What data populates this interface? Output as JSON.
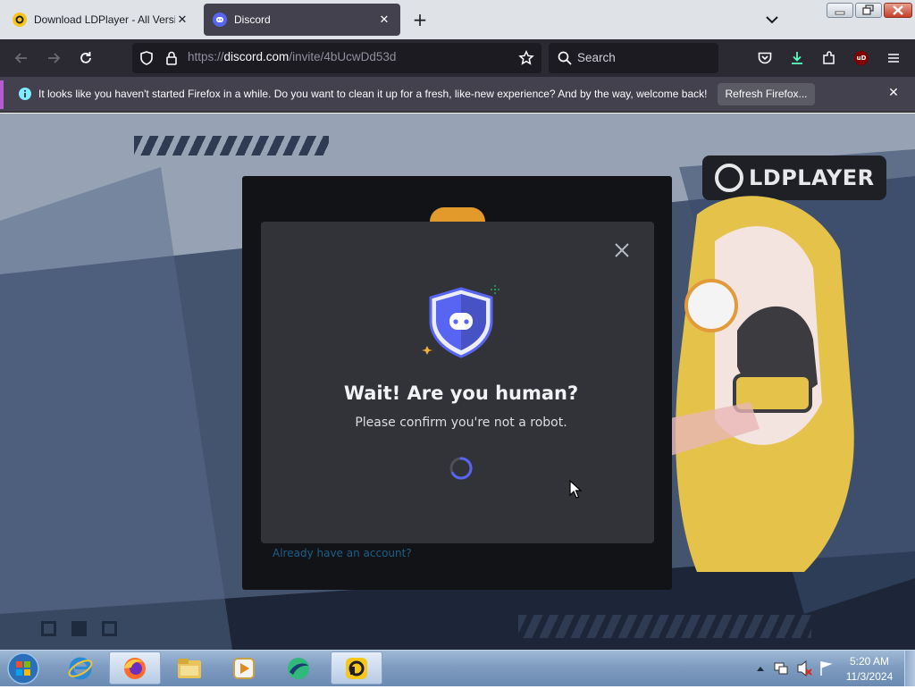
{
  "browser": {
    "tabs": [
      {
        "title": "Download LDPlayer - All Versio",
        "favicon": "ldplayer-icon",
        "active": false
      },
      {
        "title": "Discord",
        "favicon": "discord-icon",
        "active": true
      }
    ],
    "url_prefix": "https://",
    "url_host": "discord.com",
    "url_path": "/invite/4bUcwDd53d",
    "search_placeholder": "Search",
    "notification": {
      "text": "It looks like you haven't started Firefox in a while. Do you want to clean it up for a fresh, like-new experience? And by the way, welcome back!",
      "button": "Refresh Firefox..."
    },
    "extension_badge": "uD"
  },
  "page": {
    "logo_text": "LDPLAYER",
    "background_link": "Already have an account?"
  },
  "modal": {
    "title": "Wait! Are you human?",
    "subtitle": "Please confirm you're not a robot."
  },
  "taskbar": {
    "pinned": [
      "internet-explorer-icon",
      "firefox-icon",
      "file-explorer-icon",
      "media-player-icon",
      "bluestacks-icon",
      "ldplayer-icon"
    ],
    "clock_time": "5:20 AM",
    "clock_date": "11/3/2024"
  },
  "colors": {
    "discord_blurple": "#5865f2",
    "modal_bg": "#313338",
    "firefox_toolbar": "#2b2a33",
    "notification_accent": "#b35bd0"
  }
}
